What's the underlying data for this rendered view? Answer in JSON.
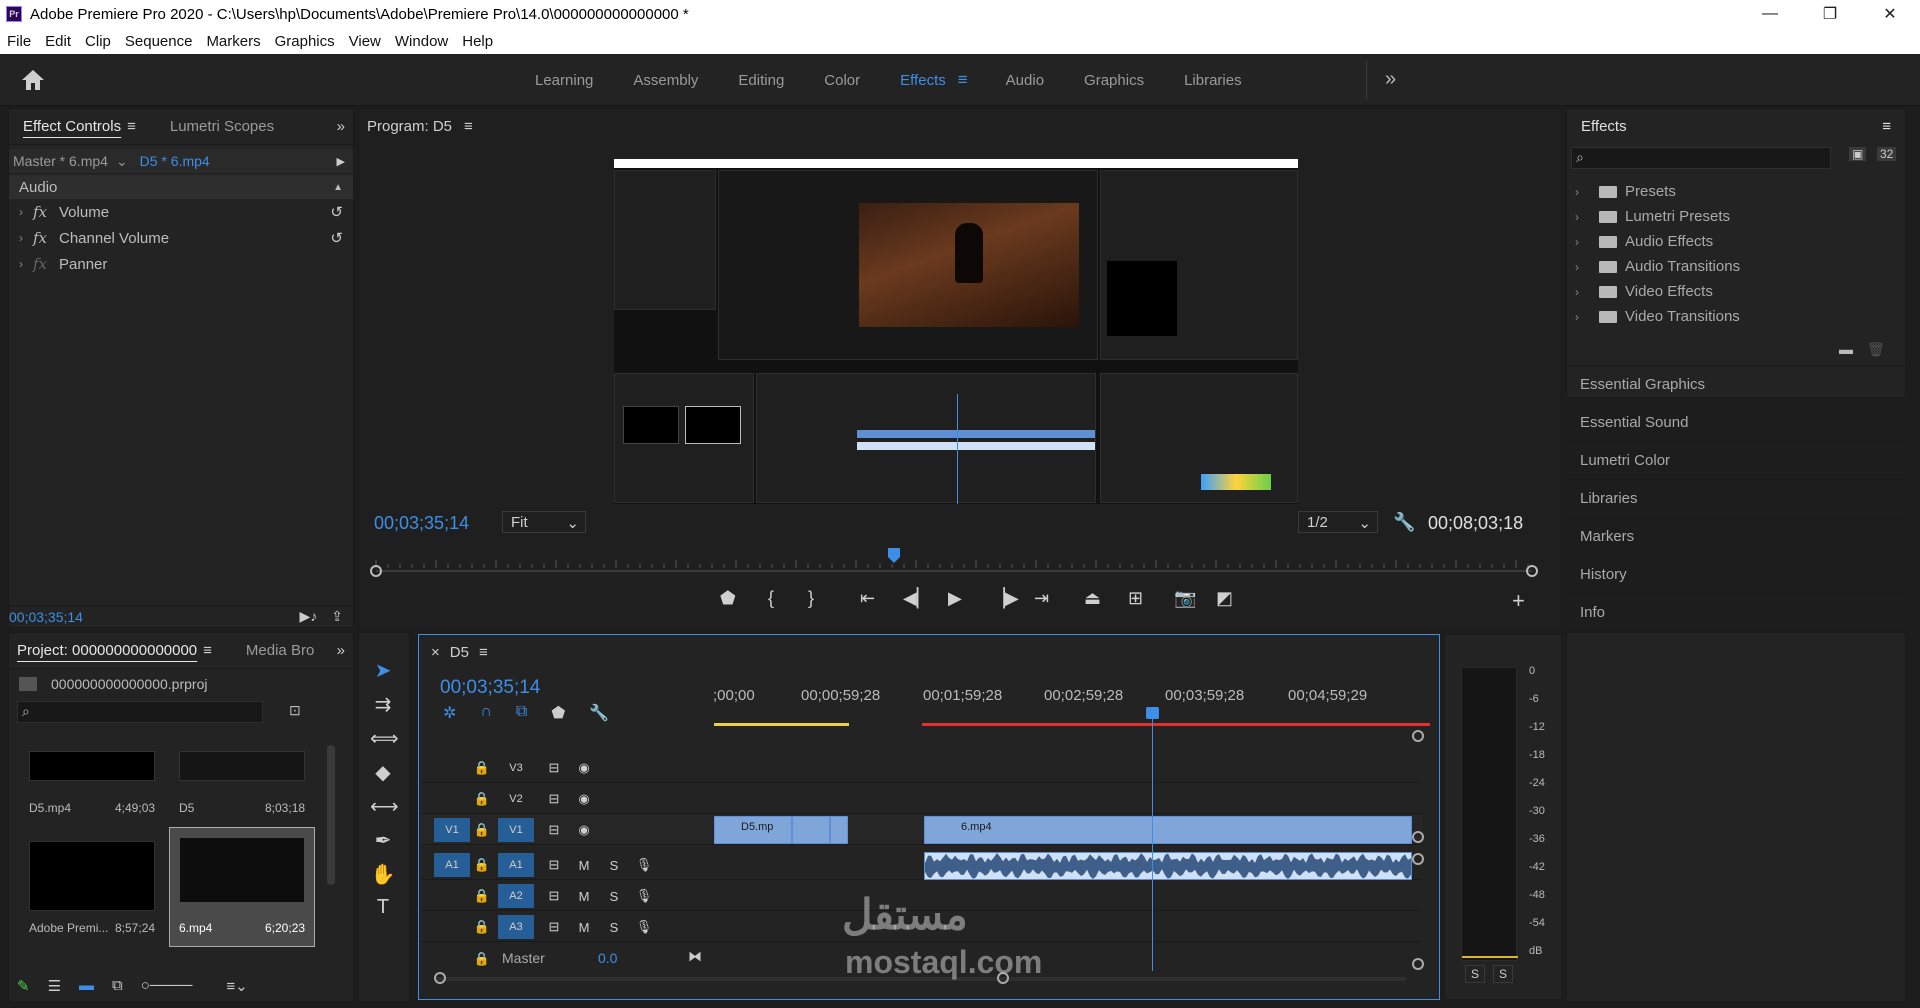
{
  "window": {
    "title": "Adobe Premiere Pro 2020 - C:\\Users\\hp\\Documents\\Adobe\\Premiere Pro\\14.0\\000000000000000 *",
    "app_icon": "Pr",
    "minimize": "—",
    "restore": "❐",
    "close": "✕"
  },
  "menu": [
    "File",
    "Edit",
    "Clip",
    "Sequence",
    "Markers",
    "Graphics",
    "View",
    "Window",
    "Help"
  ],
  "workspaces": {
    "items": [
      "Learning",
      "Assembly",
      "Editing",
      "Color",
      "Effects",
      "Audio",
      "Graphics",
      "Libraries"
    ],
    "active": "Effects",
    "active_menu": "≡",
    "more": "»"
  },
  "effect_controls": {
    "tabs": [
      "Effect Controls",
      "Lumetri Scopes"
    ],
    "menu_icon": "≡",
    "expand": "»",
    "master_clip": "Master * 6.mp4",
    "sequence_clip": "D5 * 6.mp4",
    "section": "Audio",
    "effects": [
      "Volume",
      "Channel Volume",
      "Panner"
    ],
    "fx": "fx",
    "timecode": "00;03;35;14"
  },
  "program": {
    "title": "Program: D5",
    "menu_icon": "≡",
    "timecode": "00;03;35;14",
    "fit": "Fit",
    "resolution": "1/2",
    "duration": "00;08;03;18",
    "add": "+"
  },
  "effects_panel": {
    "title": "Effects",
    "menu_icon": "≡",
    "badge": "32",
    "folders": [
      "Presets",
      "Lumetri Presets",
      "Audio Effects",
      "Audio Transitions",
      "Video Effects",
      "Video Transitions"
    ],
    "sidebar": [
      "Essential Graphics",
      "Essential Sound",
      "Lumetri Color",
      "Libraries",
      "Markers",
      "History",
      "Info"
    ]
  },
  "project": {
    "tabs": [
      "Project: 000000000000000",
      "Media Bro"
    ],
    "menu_icon": "≡",
    "expand": "»",
    "file": "000000000000000.prproj",
    "items": [
      {
        "name": "D5.mp4",
        "duration": "4;49;03"
      },
      {
        "name": "D5",
        "duration": "8;03;18"
      },
      {
        "name": "Adobe Premi...",
        "duration": "8;57;24"
      },
      {
        "name": "6.mp4",
        "duration": "6;20;23"
      }
    ]
  },
  "timeline": {
    "title": "D5",
    "close": "×",
    "menu_icon": "≡",
    "timecode": "00;03;35;14",
    "ruler": [
      ";00;00",
      "00;00;59;28",
      "00;01;59;28",
      "00;02;59;28",
      "00;03;59;28",
      "00;04;59;29"
    ],
    "video_tracks": [
      "V3",
      "V2",
      "V1"
    ],
    "audio_tracks": [
      "A1",
      "A2",
      "A3"
    ],
    "source_v": "V1",
    "source_a": "A1",
    "mute": "M",
    "solo": "S",
    "master": "Master",
    "master_value": "0.0",
    "clips": {
      "d5": "D5.mp",
      "six": "6.mp4"
    }
  },
  "meter": {
    "labels": [
      "0",
      "-6",
      "-12",
      "-18",
      "-24",
      "-30",
      "-36",
      "-42",
      "-48",
      "-54",
      "dB"
    ],
    "solo": "S"
  },
  "watermark": {
    "arabic": "مستقل",
    "latin": "mostaql.com"
  },
  "colors": {
    "accent": "#3d8ee6",
    "clip_video": "#80a6d9",
    "clip_audio": "#cfe0f7",
    "playhead": "#3d8ee6",
    "bg": "#1d1d1d",
    "panel": "#232323"
  }
}
